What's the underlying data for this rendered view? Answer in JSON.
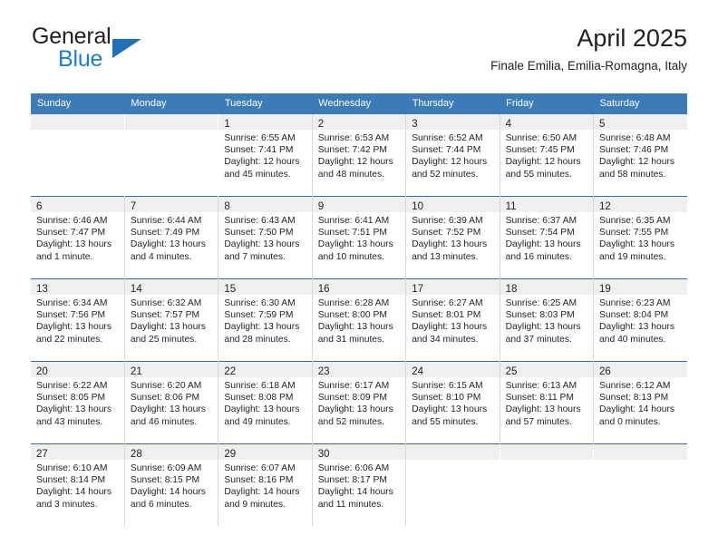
{
  "brand": {
    "word_one": "General",
    "word_two": "Blue",
    "triangle_icon": "triangle-icon",
    "accent_color": "#1b7fd0",
    "triangle_color": "#1b72b8"
  },
  "header": {
    "title": "April 2025",
    "subtitle": "Finale Emilia, Emilia-Romagna, Italy"
  },
  "theme": {
    "header_row_bg": "#3b7cb8",
    "header_row_text": "#ffffff",
    "daynum_band_bg": "#efefef",
    "row_separator": "#2f6ca8",
    "text": "#231f20"
  },
  "calendar": {
    "weekday_headers": [
      "Sunday",
      "Monday",
      "Tuesday",
      "Wednesday",
      "Thursday",
      "Friday",
      "Saturday"
    ],
    "weeks": [
      [
        {
          "day": "",
          "sunrise": "",
          "sunset": "",
          "daylight_line1": "",
          "daylight_line2": ""
        },
        {
          "day": "",
          "sunrise": "",
          "sunset": "",
          "daylight_line1": "",
          "daylight_line2": ""
        },
        {
          "day": "1",
          "sunrise": "Sunrise: 6:55 AM",
          "sunset": "Sunset: 7:41 PM",
          "daylight_line1": "Daylight: 12 hours",
          "daylight_line2": "and 45 minutes."
        },
        {
          "day": "2",
          "sunrise": "Sunrise: 6:53 AM",
          "sunset": "Sunset: 7:42 PM",
          "daylight_line1": "Daylight: 12 hours",
          "daylight_line2": "and 48 minutes."
        },
        {
          "day": "3",
          "sunrise": "Sunrise: 6:52 AM",
          "sunset": "Sunset: 7:44 PM",
          "daylight_line1": "Daylight: 12 hours",
          "daylight_line2": "and 52 minutes."
        },
        {
          "day": "4",
          "sunrise": "Sunrise: 6:50 AM",
          "sunset": "Sunset: 7:45 PM",
          "daylight_line1": "Daylight: 12 hours",
          "daylight_line2": "and 55 minutes."
        },
        {
          "day": "5",
          "sunrise": "Sunrise: 6:48 AM",
          "sunset": "Sunset: 7:46 PM",
          "daylight_line1": "Daylight: 12 hours",
          "daylight_line2": "and 58 minutes."
        }
      ],
      [
        {
          "day": "6",
          "sunrise": "Sunrise: 6:46 AM",
          "sunset": "Sunset: 7:47 PM",
          "daylight_line1": "Daylight: 13 hours",
          "daylight_line2": "and 1 minute."
        },
        {
          "day": "7",
          "sunrise": "Sunrise: 6:44 AM",
          "sunset": "Sunset: 7:49 PM",
          "daylight_line1": "Daylight: 13 hours",
          "daylight_line2": "and 4 minutes."
        },
        {
          "day": "8",
          "sunrise": "Sunrise: 6:43 AM",
          "sunset": "Sunset: 7:50 PM",
          "daylight_line1": "Daylight: 13 hours",
          "daylight_line2": "and 7 minutes."
        },
        {
          "day": "9",
          "sunrise": "Sunrise: 6:41 AM",
          "sunset": "Sunset: 7:51 PM",
          "daylight_line1": "Daylight: 13 hours",
          "daylight_line2": "and 10 minutes."
        },
        {
          "day": "10",
          "sunrise": "Sunrise: 6:39 AM",
          "sunset": "Sunset: 7:52 PM",
          "daylight_line1": "Daylight: 13 hours",
          "daylight_line2": "and 13 minutes."
        },
        {
          "day": "11",
          "sunrise": "Sunrise: 6:37 AM",
          "sunset": "Sunset: 7:54 PM",
          "daylight_line1": "Daylight: 13 hours",
          "daylight_line2": "and 16 minutes."
        },
        {
          "day": "12",
          "sunrise": "Sunrise: 6:35 AM",
          "sunset": "Sunset: 7:55 PM",
          "daylight_line1": "Daylight: 13 hours",
          "daylight_line2": "and 19 minutes."
        }
      ],
      [
        {
          "day": "13",
          "sunrise": "Sunrise: 6:34 AM",
          "sunset": "Sunset: 7:56 PM",
          "daylight_line1": "Daylight: 13 hours",
          "daylight_line2": "and 22 minutes."
        },
        {
          "day": "14",
          "sunrise": "Sunrise: 6:32 AM",
          "sunset": "Sunset: 7:57 PM",
          "daylight_line1": "Daylight: 13 hours",
          "daylight_line2": "and 25 minutes."
        },
        {
          "day": "15",
          "sunrise": "Sunrise: 6:30 AM",
          "sunset": "Sunset: 7:59 PM",
          "daylight_line1": "Daylight: 13 hours",
          "daylight_line2": "and 28 minutes."
        },
        {
          "day": "16",
          "sunrise": "Sunrise: 6:28 AM",
          "sunset": "Sunset: 8:00 PM",
          "daylight_line1": "Daylight: 13 hours",
          "daylight_line2": "and 31 minutes."
        },
        {
          "day": "17",
          "sunrise": "Sunrise: 6:27 AM",
          "sunset": "Sunset: 8:01 PM",
          "daylight_line1": "Daylight: 13 hours",
          "daylight_line2": "and 34 minutes."
        },
        {
          "day": "18",
          "sunrise": "Sunrise: 6:25 AM",
          "sunset": "Sunset: 8:03 PM",
          "daylight_line1": "Daylight: 13 hours",
          "daylight_line2": "and 37 minutes."
        },
        {
          "day": "19",
          "sunrise": "Sunrise: 6:23 AM",
          "sunset": "Sunset: 8:04 PM",
          "daylight_line1": "Daylight: 13 hours",
          "daylight_line2": "and 40 minutes."
        }
      ],
      [
        {
          "day": "20",
          "sunrise": "Sunrise: 6:22 AM",
          "sunset": "Sunset: 8:05 PM",
          "daylight_line1": "Daylight: 13 hours",
          "daylight_line2": "and 43 minutes."
        },
        {
          "day": "21",
          "sunrise": "Sunrise: 6:20 AM",
          "sunset": "Sunset: 8:06 PM",
          "daylight_line1": "Daylight: 13 hours",
          "daylight_line2": "and 46 minutes."
        },
        {
          "day": "22",
          "sunrise": "Sunrise: 6:18 AM",
          "sunset": "Sunset: 8:08 PM",
          "daylight_line1": "Daylight: 13 hours",
          "daylight_line2": "and 49 minutes."
        },
        {
          "day": "23",
          "sunrise": "Sunrise: 6:17 AM",
          "sunset": "Sunset: 8:09 PM",
          "daylight_line1": "Daylight: 13 hours",
          "daylight_line2": "and 52 minutes."
        },
        {
          "day": "24",
          "sunrise": "Sunrise: 6:15 AM",
          "sunset": "Sunset: 8:10 PM",
          "daylight_line1": "Daylight: 13 hours",
          "daylight_line2": "and 55 minutes."
        },
        {
          "day": "25",
          "sunrise": "Sunrise: 6:13 AM",
          "sunset": "Sunset: 8:11 PM",
          "daylight_line1": "Daylight: 13 hours",
          "daylight_line2": "and 57 minutes."
        },
        {
          "day": "26",
          "sunrise": "Sunrise: 6:12 AM",
          "sunset": "Sunset: 8:13 PM",
          "daylight_line1": "Daylight: 14 hours",
          "daylight_line2": "and 0 minutes."
        }
      ],
      [
        {
          "day": "27",
          "sunrise": "Sunrise: 6:10 AM",
          "sunset": "Sunset: 8:14 PM",
          "daylight_line1": "Daylight: 14 hours",
          "daylight_line2": "and 3 minutes."
        },
        {
          "day": "28",
          "sunrise": "Sunrise: 6:09 AM",
          "sunset": "Sunset: 8:15 PM",
          "daylight_line1": "Daylight: 14 hours",
          "daylight_line2": "and 6 minutes."
        },
        {
          "day": "29",
          "sunrise": "Sunrise: 6:07 AM",
          "sunset": "Sunset: 8:16 PM",
          "daylight_line1": "Daylight: 14 hours",
          "daylight_line2": "and 9 minutes."
        },
        {
          "day": "30",
          "sunrise": "Sunrise: 6:06 AM",
          "sunset": "Sunset: 8:17 PM",
          "daylight_line1": "Daylight: 14 hours",
          "daylight_line2": "and 11 minutes."
        },
        {
          "day": "",
          "sunrise": "",
          "sunset": "",
          "daylight_line1": "",
          "daylight_line2": ""
        },
        {
          "day": "",
          "sunrise": "",
          "sunset": "",
          "daylight_line1": "",
          "daylight_line2": ""
        },
        {
          "day": "",
          "sunrise": "",
          "sunset": "",
          "daylight_line1": "",
          "daylight_line2": ""
        }
      ]
    ]
  }
}
